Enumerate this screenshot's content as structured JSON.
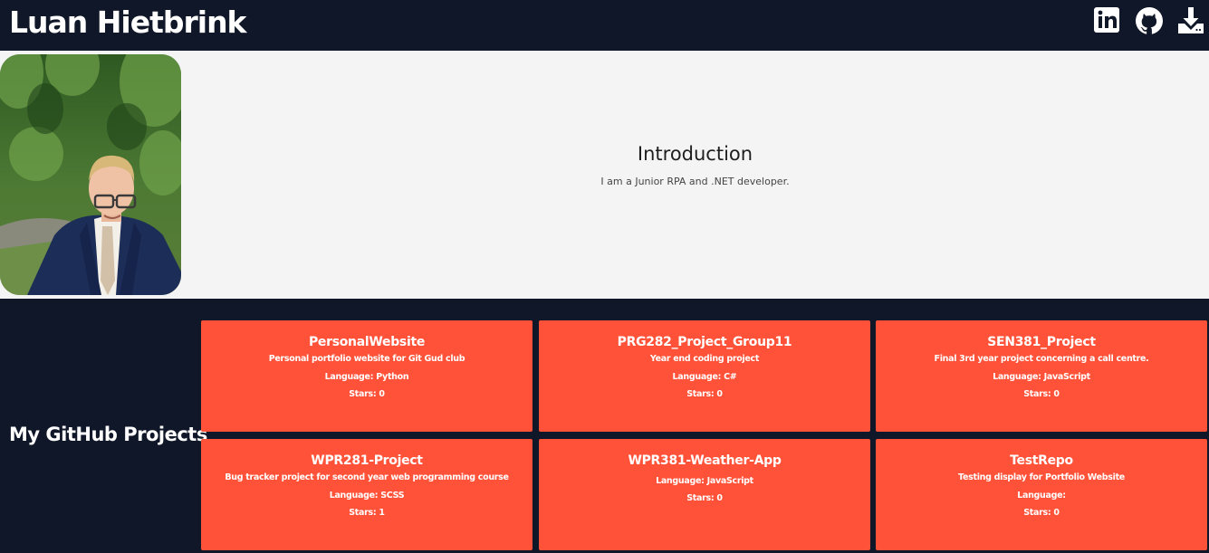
{
  "header": {
    "title": "Luan Hietbrink",
    "icons": [
      "linkedin-icon",
      "github-icon",
      "download-icon"
    ]
  },
  "intro": {
    "heading": "Introduction",
    "text": "I am a Junior RPA and .NET developer."
  },
  "projects": {
    "heading": "My GitHub Projects",
    "items": [
      {
        "name": "PersonalWebsite",
        "description": "Personal portfolio website for Git Gud club",
        "language": "Language: Python",
        "stars": "Stars: 0"
      },
      {
        "name": "PRG282_Project_Group11",
        "description": "Year end coding project",
        "language": "Language: C#",
        "stars": "Stars: 0"
      },
      {
        "name": "SEN381_Project",
        "description": "Final 3rd year project concerning a call centre.",
        "language": "Language: JavaScript",
        "stars": "Stars: 0"
      },
      {
        "name": "WPR281-Project",
        "description": "Bug tracker project for second year web programming course",
        "language": "Language: SCSS",
        "stars": "Stars: 1"
      },
      {
        "name": "WPR381-Weather-App",
        "description": "",
        "language": "Language: JavaScript",
        "stars": "Stars: 0"
      },
      {
        "name": "TestRepo",
        "description": "Testing display for Portfolio Website",
        "language": "Language:",
        "stars": "Stars: 0"
      }
    ]
  },
  "colors": {
    "background": "#101728",
    "intro_bg": "#f4f4f4",
    "card": "#ff5238"
  }
}
